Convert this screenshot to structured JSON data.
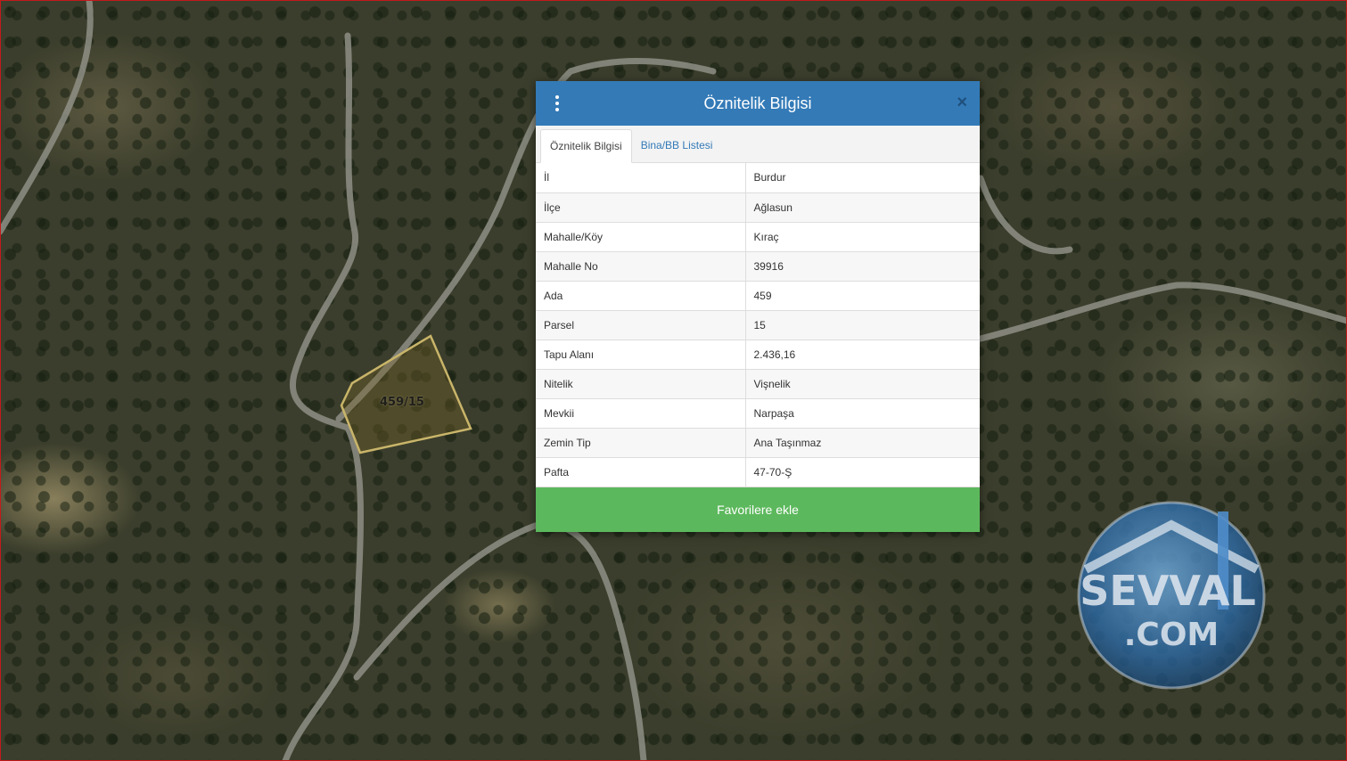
{
  "map": {
    "parcel_label": "459/15"
  },
  "dialog": {
    "title": "Öznitelik Bilgisi",
    "tabs": [
      {
        "label": "Öznitelik Bilgisi",
        "active": true
      },
      {
        "label": "Bina/BB Listesi",
        "active": false
      }
    ],
    "rows": [
      {
        "key": "İl",
        "value": "Burdur"
      },
      {
        "key": "İlçe",
        "value": "Ağlasun"
      },
      {
        "key": "Mahalle/Köy",
        "value": "Kıraç"
      },
      {
        "key": "Mahalle No",
        "value": "39916"
      },
      {
        "key": "Ada",
        "value": "459"
      },
      {
        "key": "Parsel",
        "value": "15"
      },
      {
        "key": "Tapu Alanı",
        "value": "2.436,16"
      },
      {
        "key": "Nitelik",
        "value": "Vişnelik"
      },
      {
        "key": "Mevkii",
        "value": "Narpaşa"
      },
      {
        "key": "Zemin Tip",
        "value": "Ana Taşınmaz"
      },
      {
        "key": "Pafta",
        "value": "47-70-Ş"
      }
    ],
    "favorite_label": "Favorilere ekle",
    "close_glyph": "×"
  },
  "watermark": {
    "line1": "SEVVAL",
    "line2": ".COM"
  },
  "colors": {
    "header": "#337ab7",
    "favorite": "#5cb85c",
    "parcel_outline": "#c9b56a"
  }
}
